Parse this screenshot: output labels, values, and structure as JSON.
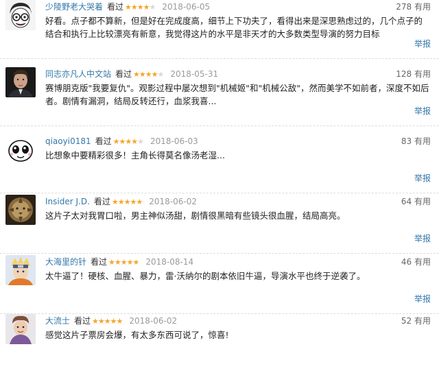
{
  "ui": {
    "watched_label": "看过",
    "report_label": "举报",
    "star_color": "#f3a62c",
    "link_color": "#3377aa"
  },
  "reviews": [
    {
      "username": "少陵野老大哭着",
      "rating": 4,
      "stars": "★★★★☆",
      "date": "2018-06-05",
      "useful": "278 有用",
      "text": "好看。点子都不算新，但是好在完成度高，细节上下功夫了，看得出来是深思熟虑过的，几个点子的结合和执行上比较漂亮有新意，我觉得这片的水平是非天才的大多数类型导演的努力目标",
      "avatar": "anime-glasses-girl"
    },
    {
      "username": "同志亦凡人中文站",
      "rating": 4,
      "stars": "★★★★☆",
      "date": "2018-05-31",
      "useful": "128 有用",
      "text": "赛博朋克版\"我要复仇\"。观影过程中屡次想到\"机械姬\"和\"机械公敌\"，然而美学不如前者，深度不如后者。剧情有漏洞，结局反转还行，血浆我喜...",
      "avatar": "man-portrait"
    },
    {
      "username": "qiaoyi0181",
      "rating": 4,
      "stars": "★★★★☆",
      "date": "2018-06-03",
      "useful": "83 有用",
      "text": "比想象中要精彩很多！主角长得莫名像汤老湿...",
      "avatar": "cartoon-face"
    },
    {
      "username": "Insider J.D.",
      "rating": 5,
      "stars": "★★★★★",
      "date": "2018-06-02",
      "useful": "64 有用",
      "text": "这片子太对我胃口啦，男主神似汤甜，剧情很黑暗有些镜头很血腥，结局高亮。",
      "avatar": "lion-art"
    },
    {
      "username": "大海里的针",
      "rating": 5,
      "stars": "★★★★★",
      "date": "2018-08-14",
      "useful": "46 有用",
      "text": "太牛逼了！硬核、血腥、暴力，雷·沃纳尔的剧本依旧牛逼，导演水平也终于逆袭了。",
      "avatar": "anime-ninja"
    },
    {
      "username": "大流士",
      "rating": 5,
      "stars": "★★★★★",
      "date": "2018-06-02",
      "useful": "52 有用",
      "text": "感觉这片子票房会爆，有太多东西可说了，惊喜!",
      "avatar": "cartoon-character"
    }
  ]
}
